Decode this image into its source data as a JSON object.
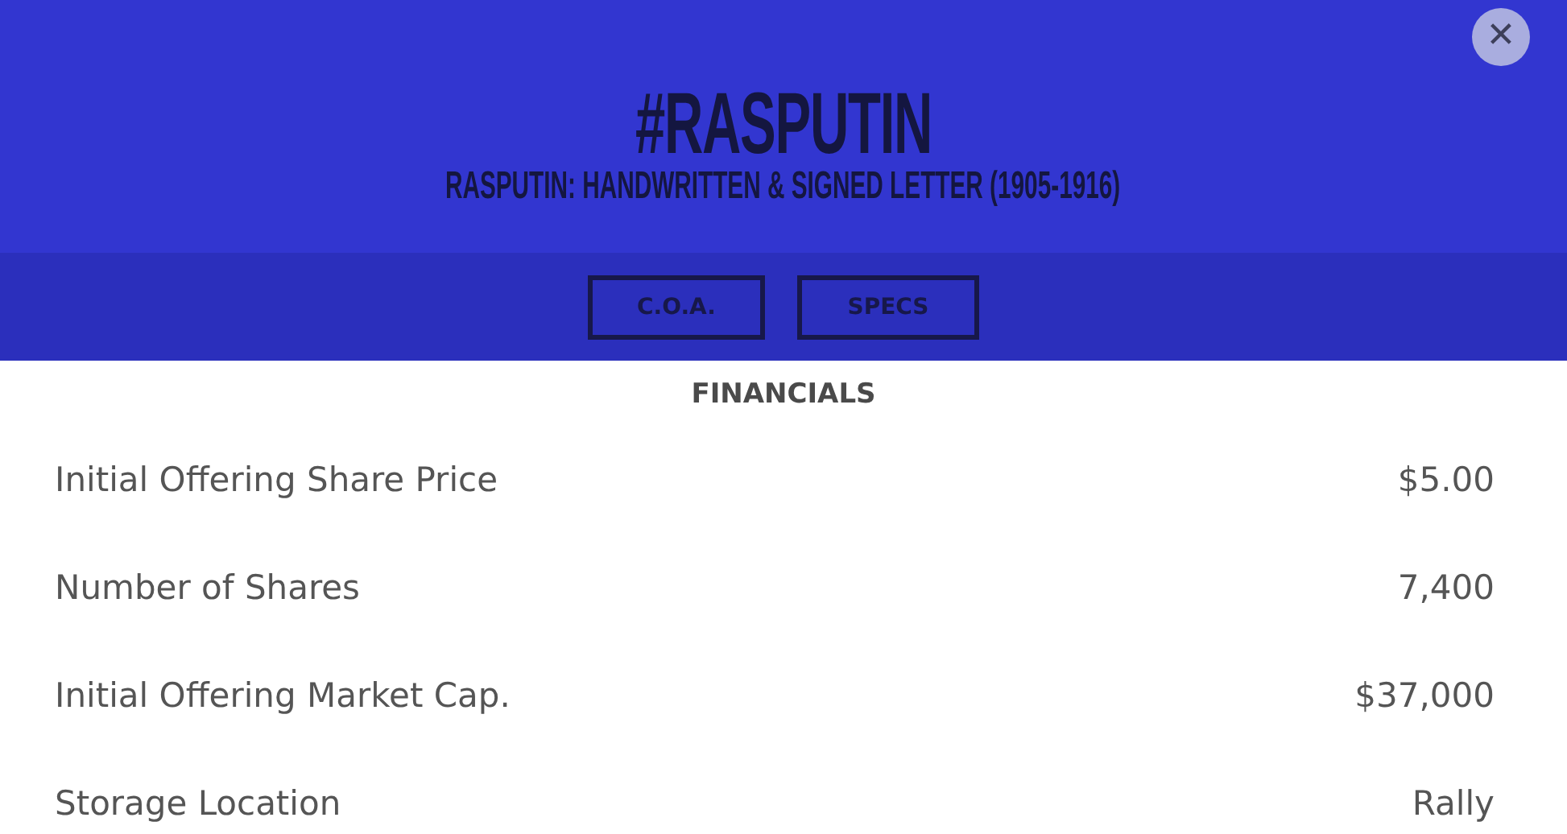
{
  "title": "#RASPUTIN",
  "subtitle": "RASPUTIN: HANDWRITTEN & SIGNED LETTER (1905-1916)",
  "close": {
    "label": "✕"
  },
  "buttons": [
    "C.O.A.",
    "SPECS"
  ],
  "section": "FINANCIALS",
  "rows": [
    {
      "label": "Initial Offering Share Price",
      "value": "$5.00"
    },
    {
      "label": "Number of Shares",
      "value": "7,400"
    },
    {
      "label": "Initial Offering Market Cap.",
      "value": "$37,000"
    },
    {
      "label": "Storage Location",
      "value": "Rally"
    }
  ]
}
